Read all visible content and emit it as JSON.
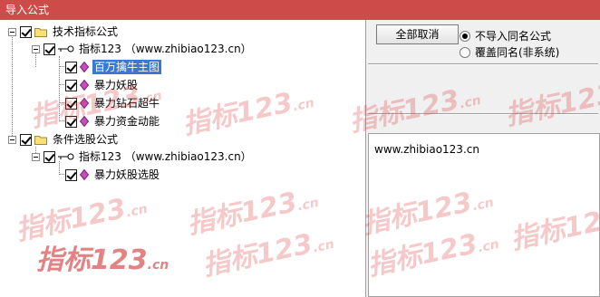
{
  "window": {
    "title": "导入公式"
  },
  "tree": {
    "groups": [
      {
        "label": "技术指标公式",
        "source": "指标123 （www.zhibiao123.cn）",
        "items": [
          "百万擒牛主图",
          "暴力妖股",
          "暴力钻石超牛",
          "暴力资金动能"
        ]
      },
      {
        "label": "条件选股公式",
        "source": "指标123 （www.zhibiao123.cn）",
        "items": [
          "暴力妖股选股"
        ]
      }
    ],
    "selected_item": "百万擒牛主图"
  },
  "panel": {
    "cancel_all_label": "全部取消",
    "radio_no_import": "不导入同名公式",
    "radio_overwrite": "覆盖同名(非系统)",
    "selected_radio": "不导入同名公式",
    "info_text": "www.zhibiao123.cn"
  },
  "watermark": {
    "text": "指标123",
    "suffix": ".cn",
    "color": "#dc3c3c"
  }
}
